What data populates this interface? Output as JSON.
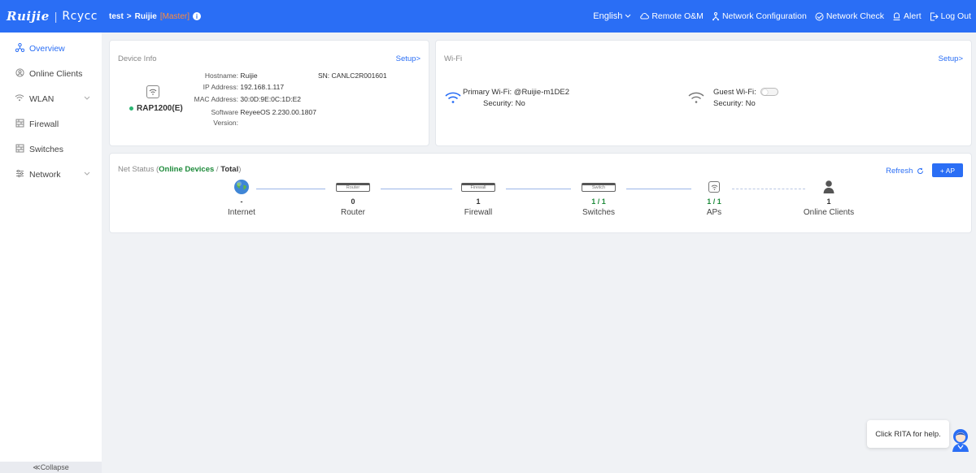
{
  "topbar": {
    "brand_logo": "Ruijie",
    "brand_separator": "|",
    "brand_sub": "Rcycc",
    "project": "test",
    "crumb_sep": ">",
    "device": "Ruijie",
    "role": "[Master]",
    "info_glyph": "i",
    "nav": {
      "language": "English",
      "remote": "Remote O&M",
      "network_config": "Network Configuration",
      "network_check": "Network Check",
      "alert": "Alert",
      "logout": "Log Out"
    },
    "accent_color": "#2a6ef5"
  },
  "sidebar": {
    "items": [
      {
        "label": "Overview",
        "icon": "overview-icon",
        "active": true
      },
      {
        "label": "Online Clients",
        "icon": "clients-icon"
      },
      {
        "label": "WLAN",
        "icon": "wifi-icon",
        "expandable": true
      },
      {
        "label": "Firewall",
        "icon": "firewall-icon"
      },
      {
        "label": "Switches",
        "icon": "switch-icon"
      },
      {
        "label": "Network",
        "icon": "network-icon",
        "expandable": true
      }
    ],
    "collapse_label": "≪Collapse"
  },
  "device_info": {
    "title": "Device Info",
    "setup": "Setup>",
    "model": "RAP1200(E)",
    "hostname_label": "Hostname:",
    "hostname": "Ruijie",
    "ip_label": "IP Address:",
    "ip": "192.168.1.117",
    "mac_label": "MAC Address:",
    "mac": "30:0D:9E:0C:1D:E2",
    "software_label": "Software",
    "version_label": "Version:",
    "software": "ReyeeOS 2.230.00.1807",
    "sn_label": "SN:",
    "sn": "CANLC2R001601"
  },
  "wifi": {
    "title": "Wi-Fi",
    "setup": "Setup>",
    "primary_label": "Primary Wi-Fi:",
    "primary_ssid": "@Ruijie-m1DE2",
    "primary_security_label": "Security:",
    "primary_security": "No",
    "guest_label": "Guest Wi-Fi:",
    "guest_security_label": "Security:",
    "guest_security": "No"
  },
  "net_status": {
    "title_prefix": "Net Status (",
    "online_devices": "Online Devices",
    "title_sep": " / ",
    "total": "Total",
    "title_suffix": ")",
    "refresh": "Refresh",
    "add_ap": "+ AP",
    "nodes": [
      {
        "label": "Internet",
        "count": "-",
        "box": ""
      },
      {
        "label": "Router",
        "count": "0",
        "box": "Router"
      },
      {
        "label": "Firewall",
        "count": "1",
        "box": "Firewall"
      },
      {
        "label": "Switches",
        "count": "1 / 1",
        "box": "Switch"
      },
      {
        "label": "APs",
        "count": "1 / 1",
        "box": ""
      },
      {
        "label": "Online Clients",
        "count": "1",
        "box": ""
      }
    ]
  },
  "help": {
    "text": "Click RITA for help."
  }
}
